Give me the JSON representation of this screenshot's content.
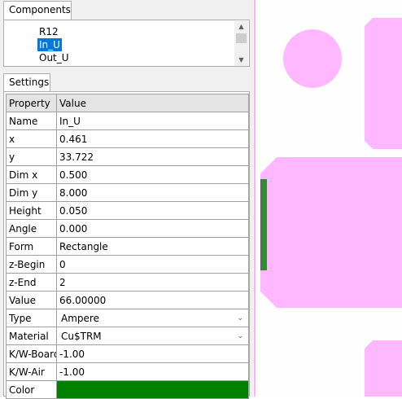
{
  "components": {
    "tab_label": "Components",
    "items": [
      {
        "label": "R12",
        "selected": false
      },
      {
        "label": "In_U",
        "selected": true
      },
      {
        "label": "Out_U",
        "selected": false
      }
    ]
  },
  "settings": {
    "tab_label": "Settings",
    "header": {
      "property": "Property",
      "value": "Value"
    },
    "rows": [
      {
        "property": "Name",
        "value": "In_U"
      },
      {
        "property": "x",
        "value": "0.461"
      },
      {
        "property": "y",
        "value": "33.722"
      },
      {
        "property": "Dim x",
        "value": "0.500"
      },
      {
        "property": "Dim y",
        "value": "8.000"
      },
      {
        "property": "Height",
        "value": "0.050"
      },
      {
        "property": "Angle",
        "value": "0.000"
      },
      {
        "property": "Form",
        "value": "Rectangle"
      },
      {
        "property": "z-Begin",
        "value": "0"
      },
      {
        "property": "z-End",
        "value": "2"
      },
      {
        "property": "Value",
        "value": "66.00000"
      },
      {
        "property": "Type",
        "value": "Ampere"
      },
      {
        "property": "Material",
        "value": "Cu$TRM"
      },
      {
        "property": "K/W-Board",
        "value": "-1.00"
      },
      {
        "property": "K/W-Air",
        "value": "-1.00"
      },
      {
        "property": "Color",
        "value": ""
      }
    ],
    "color_value": "#008000"
  },
  "canvas": {
    "pad_color": "#ffb8ff",
    "trace_color": "#328d32",
    "background": "#fefefe"
  }
}
